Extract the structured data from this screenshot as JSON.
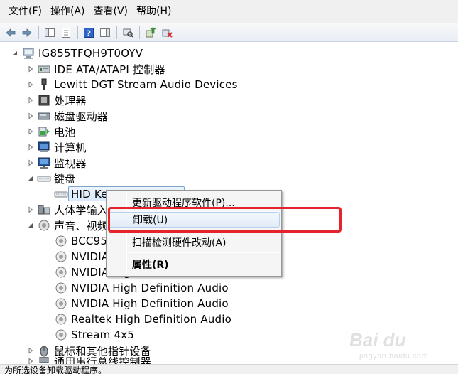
{
  "menu": [
    {
      "label": "文件(F)"
    },
    {
      "label": "操作(A)"
    },
    {
      "label": "查看(V)"
    },
    {
      "label": "帮助(H)"
    }
  ],
  "tree": {
    "root": "IG855TFQH9T0OYV",
    "categories": [
      {
        "label": "IDE ATA/ATAPI 控制器",
        "icon": "ide-controller-icon"
      },
      {
        "label": "Lewitt DGT Stream Audio Devices",
        "icon": "usb-audio-icon"
      },
      {
        "label": "处理器",
        "icon": "processor-icon"
      },
      {
        "label": "磁盘驱动器",
        "icon": "disk-drive-icon"
      },
      {
        "label": "电池",
        "icon": "battery-icon"
      },
      {
        "label": "计算机",
        "icon": "computer-icon"
      },
      {
        "label": "监视器",
        "icon": "monitor-icon"
      },
      {
        "label": "键盘",
        "icon": "keyboard-icon"
      },
      {
        "label": "人体学输入",
        "icon": "hid-icon"
      },
      {
        "label": "声音、视频",
        "icon": "sound-icon"
      },
      {
        "label": "鼠标和其他指针设备",
        "icon": "mouse-icon"
      },
      {
        "label": "通用串行总线控制器",
        "icon": "usb-controller-icon"
      }
    ],
    "keyboard_child": "HID Keyboard Device",
    "keyboard_child_visible": "HID Ke",
    "sound_children": [
      "BCC95",
      "NVIDIA",
      "NVIDIA High Definition Audio",
      "NVIDIA High Definition Audio",
      "NVIDIA High Definition Audio",
      "Realtek High Definition Audio",
      "Stream 4x5"
    ]
  },
  "context_menu": {
    "update_driver": "更新驱动程序软件(P)...",
    "uninstall": "卸载(U)",
    "scan": "扫描检测硬件改动(A)",
    "properties": "属性(R)"
  },
  "status": "为所选设备卸载驱动程序。",
  "watermark": {
    "brand": "Bai du",
    "sub": "jingyan.baidu.com"
  },
  "colors": {
    "highlight_box": "#e4242a",
    "selection": "#dbeafc"
  }
}
